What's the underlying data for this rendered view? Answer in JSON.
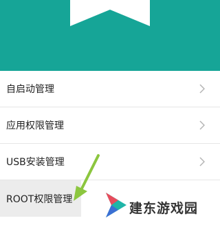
{
  "header": {
    "accent": "#16a597"
  },
  "menu": {
    "items": [
      {
        "label": "自启动管理"
      },
      {
        "label": "应用权限管理"
      },
      {
        "label": "USB安装管理"
      },
      {
        "label": "ROOT权限管理"
      }
    ],
    "chevron_icon": "chevron-right-icon",
    "highlight_color": "#ececec"
  },
  "watermark": {
    "text": "建东游戏园",
    "logo_icon": "play-triangle-logo"
  },
  "pointer": {
    "icon": "green-arrow-icon",
    "color": "#8cc63f"
  }
}
